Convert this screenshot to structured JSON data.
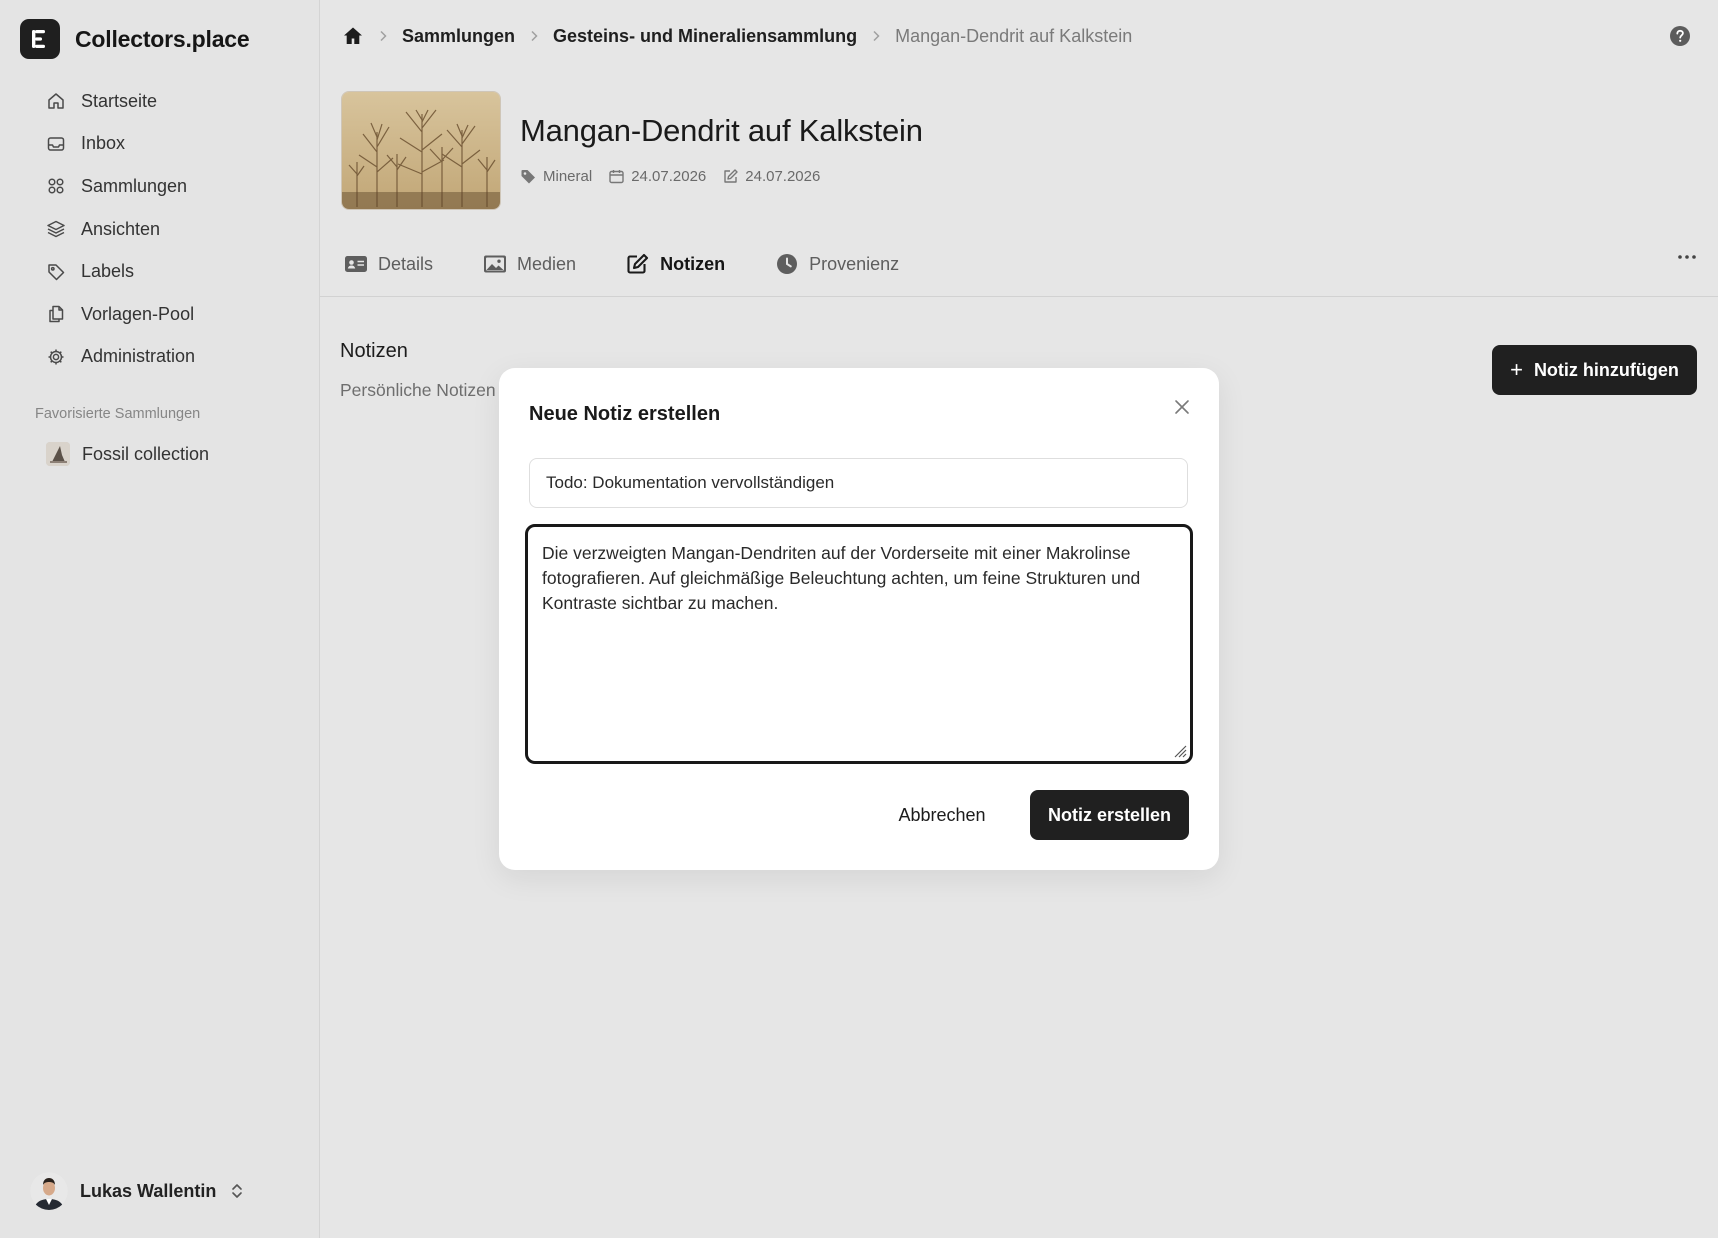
{
  "app": {
    "name": "Collectors.place"
  },
  "sidebar": {
    "items": [
      {
        "label": "Startseite",
        "icon": "home-icon"
      },
      {
        "label": "Inbox",
        "icon": "inbox-icon"
      },
      {
        "label": "Sammlungen",
        "icon": "grid-icon"
      },
      {
        "label": "Ansichten",
        "icon": "layers-icon"
      },
      {
        "label": "Labels",
        "icon": "tag-icon"
      },
      {
        "label": "Vorlagen-Pool",
        "icon": "copy-icon"
      },
      {
        "label": "Administration",
        "icon": "gear-icon"
      }
    ],
    "favorites_title": "Favorisierte Sammlungen",
    "favorites": [
      {
        "label": "Fossil collection"
      }
    ],
    "user": {
      "name": "Lukas Wallentin"
    }
  },
  "breadcrumb": {
    "items": [
      "Sammlungen",
      "Gesteins- und Mineraliensammlung"
    ],
    "current": "Mangan-Dendrit auf Kalkstein"
  },
  "object": {
    "title": "Mangan-Dendrit auf Kalkstein",
    "category": "Mineral",
    "created": "24.07.2026",
    "modified": "24.07.2026"
  },
  "tabs": [
    {
      "label": "Details",
      "icon": "id-card-icon",
      "active": false
    },
    {
      "label": "Medien",
      "icon": "image-icon",
      "active": false
    },
    {
      "label": "Notizen",
      "icon": "edit-icon",
      "active": true
    },
    {
      "label": "Provenienz",
      "icon": "clock-icon",
      "active": false
    }
  ],
  "notes_section": {
    "title": "Notizen",
    "subtitle": "Persönliche Notizen",
    "add_button": "Notiz hinzufügen"
  },
  "modal": {
    "title": "Neue Notiz erstellen",
    "note_title_value": "Todo: Dokumentation vervollständigen",
    "note_body_value": "Die verzweigten Mangan-Dendriten auf der Vorderseite mit einer Makrolinse fotografieren. Auf gleichmäßige Beleuchtung achten, um feine Strukturen und Kontraste sichtbar zu machen.",
    "cancel_label": "Abbrechen",
    "submit_label": "Notiz erstellen"
  },
  "colors": {
    "accent": "#202020",
    "background": "#e6e6e6",
    "spellcheck": "#e23b3b"
  }
}
